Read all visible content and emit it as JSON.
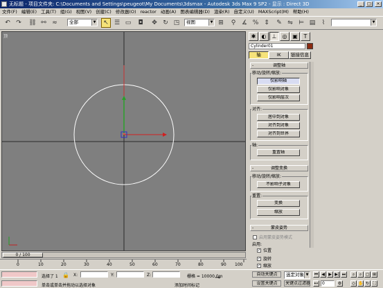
{
  "window": {
    "title": "无标题    - 项目文件夹: C:\\Documents and Settings\\peugeot\\My Documents\\3dsmax    - Autodesk 3ds Max 9 SP2    - 显示 : Direct 3D",
    "min": "_",
    "max": "□",
    "close": "×"
  },
  "menu": [
    "文件(F)",
    "编辑(E)",
    "工具(T)",
    "组(G)",
    "视图(V)",
    "创建(C)",
    "修改器(O)",
    "reactor",
    "动画(A)",
    "图表编辑器(D)",
    "渲染(R)",
    "自定义(U)",
    "MAXScript(M)",
    "帮助(H)"
  ],
  "toolbar": {
    "icons": [
      "undo-icon",
      "redo-icon",
      "link-icon",
      "unlink-icon",
      "bind-space-warp-icon"
    ],
    "selection_filter": "全部",
    "select_icons": [
      "select-object-icon",
      "select-by-name-icon",
      "rect-region-icon",
      "window-crossing-icon",
      "select-move-icon",
      "select-rotate-icon",
      "select-scale-icon"
    ],
    "ref_coord": "视图",
    "right_icons": [
      "pivot-icon",
      "snap-icon",
      "angle-snap-icon",
      "percent-snap-icon",
      "spinner-snap-icon",
      "mirror-icon",
      "align-icon"
    ]
  },
  "viewport": {
    "label": "顶"
  },
  "timeline": {
    "frame": "0 / 100",
    "ticks": [
      "0",
      "10",
      "20",
      "30",
      "40",
      "50",
      "60",
      "70",
      "80",
      "90",
      "100"
    ]
  },
  "cmd": {
    "object_name": "Cylinder01",
    "tabs": [
      "轴",
      "IK",
      "链接信息"
    ],
    "rollout_adjust_pivot": "调整轴",
    "grp_move": "移动/旋转/缩放:",
    "btn_affect_pivot": "仅影响轴",
    "btn_affect_object": "仅影响对象",
    "btn_affect_hierarchy": "仅影响层次",
    "grp_align": "对齐:",
    "btn_center": "居中到对象",
    "btn_align_obj": "对齐到对象",
    "btn_align_world": "对齐到世界",
    "grp_pivot": "轴:",
    "btn_reset_pivot": "重置轴",
    "rollout_adjust_transform": "调整变换",
    "grp_move2": "移动/旋转/缩放:",
    "btn_dont_affect": "不影响子对象",
    "grp_reset": "重置:",
    "btn_transform": "变换",
    "btn_scale": "缩放",
    "rollout_skin_pose": "蒙皮姿势",
    "chk_enable": "启用蒙皮姿势模式",
    "grp_enable": "启用:",
    "chk_pos": "位置",
    "chk_rot": "旋转",
    "chk_scale": "缩放"
  },
  "status": {
    "selected": "选择了 1",
    "x_label": "X:",
    "y_label": "Y:",
    "z_label": "Z:",
    "x_val": "",
    "y_val": "",
    "z_val": "",
    "grid": "栅格 = 10000.0m",
    "prompt": "单击或单击并拖动以选择对象",
    "add_time_tag": "添加时间标记",
    "auto_key": "自动关键点",
    "set_key": "设置关键点",
    "filter_sel": "选定对象",
    "key_filters": "关键点过滤器...",
    "frame_val": "0"
  }
}
